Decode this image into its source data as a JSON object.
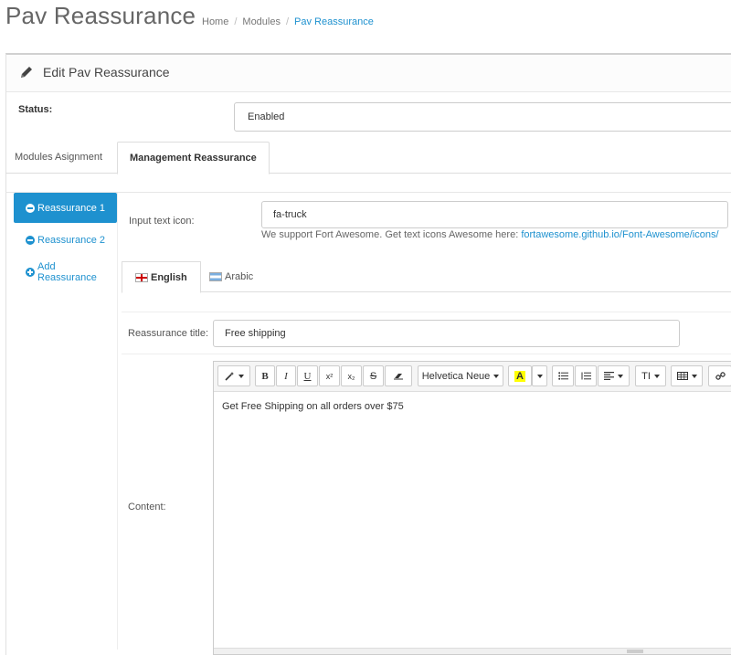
{
  "header": {
    "title": "Pav Reassurance",
    "breadcrumb": [
      "Home",
      "Modules",
      "Pav Reassurance"
    ]
  },
  "panel": {
    "title": "Edit Pav Reassurance"
  },
  "status": {
    "label": "Status:",
    "value": "Enabled"
  },
  "tabs": [
    {
      "label": "Modules Asignment"
    },
    {
      "label": "Management Reassurance"
    }
  ],
  "sidebar": {
    "items": [
      {
        "label": "Reassurance 1"
      },
      {
        "label": "Reassurance 2"
      },
      {
        "label": "Add Reassurance"
      }
    ]
  },
  "icon_field": {
    "label": "Input text icon:",
    "value": "fa-truck",
    "help_text": "We support Fort Awesome. Get text icons Awesome here:",
    "help_link": "fortawesome.github.io/Font-Awesome/icons/"
  },
  "languages": [
    {
      "label": "English"
    },
    {
      "label": "Arabic"
    }
  ],
  "title_field": {
    "label": "Reassurance title:",
    "value": "Free shipping"
  },
  "content_field": {
    "label": "Content:",
    "text": "Get Free Shipping on all orders over $75"
  },
  "toolbar": {
    "bold": "B",
    "italic": "I",
    "underline": "U",
    "superscript": "x²",
    "subscript": "x₂",
    "strike": "S",
    "font": "Helvetica Neue",
    "highlight": "A",
    "size": "TI"
  },
  "colors": {
    "accent": "#1e91cf",
    "highlight": "#ffff00"
  }
}
